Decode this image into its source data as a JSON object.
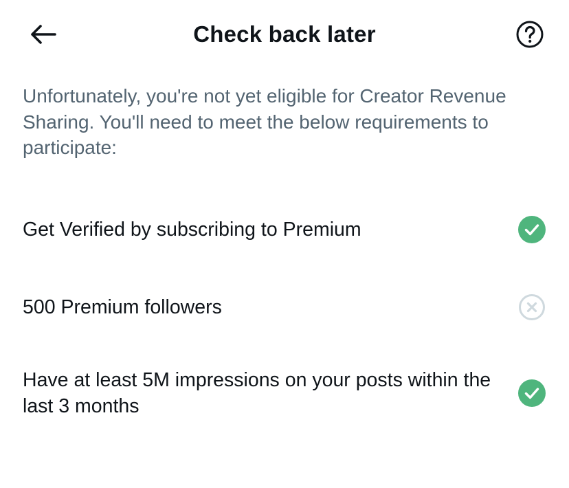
{
  "header": {
    "title": "Check back later",
    "back_icon": "arrow-left-icon",
    "help_icon": "question-circle-icon"
  },
  "intro": {
    "text": "Unfortunately, you're not yet eligible for Creator Revenue Sharing. You'll need to meet the below requirements to participate:"
  },
  "requirements": [
    {
      "label": "Get Verified by subscribing to Premium",
      "status": "met",
      "icon": "check-circle-icon"
    },
    {
      "label": "500 Premium followers",
      "status": "not-met",
      "icon": "x-circle-icon"
    },
    {
      "label": "Have at least 5M impressions on your posts within the last 3 months",
      "status": "met",
      "icon": "check-circle-icon"
    }
  ],
  "colors": {
    "met": "#4fb57d",
    "not_met": "#cfd9de",
    "secondary_text": "#536471",
    "primary_text": "#0f1419"
  }
}
